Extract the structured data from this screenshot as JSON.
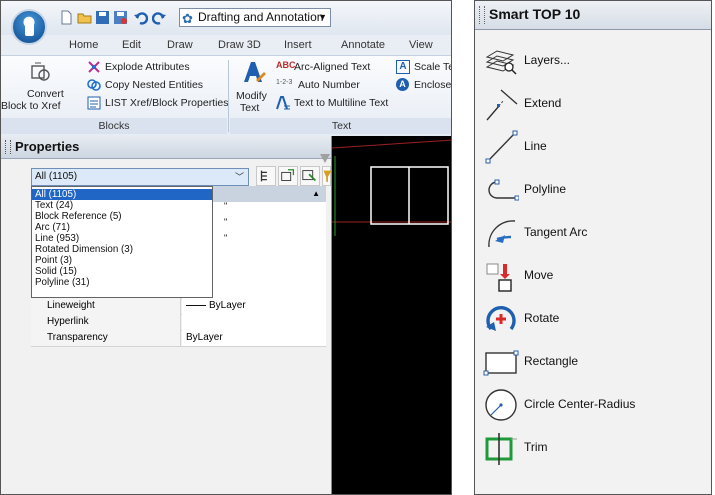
{
  "quick_access": {
    "workspace": "Drafting and Annotation"
  },
  "ribbon": {
    "tabs": [
      "Home",
      "Edit",
      "Draw",
      "Draw 3D",
      "Insert",
      "Annotate",
      "View"
    ],
    "blocks": {
      "convert_label_1": "Convert",
      "convert_label_2": "Block to Xref",
      "explode_attributes": "Explode Attributes",
      "copy_nested": "Copy Nested Entities",
      "list_xref": "LIST Xref/Block Properties",
      "group_label": "Blocks"
    },
    "text": {
      "modify_label_1": "Modify",
      "modify_label_2": "Text",
      "arc_aligned": "Arc-Aligned Text",
      "auto_number": "Auto Number",
      "text_to_multiline": "Text to Multiline Text",
      "scale_text": "Scale Tex",
      "enclose": "Enclose",
      "group_label": "Text"
    }
  },
  "properties": {
    "title": "Properties",
    "selection_value": "All (1105)",
    "dropdown_options": [
      "All (1105)",
      "Text (24)",
      "Block Reference (5)",
      "Arc (71)",
      "Line (953)",
      "Rotated Dimension (3)",
      "Point (3)",
      "Solid (15)",
      "Polyline (31)"
    ],
    "rows": [
      {
        "name": "Lineweight",
        "value": "ByLayer",
        "line": true
      },
      {
        "name": "Hyperlink",
        "value": ""
      },
      {
        "name": "Transparency",
        "value": "ByLayer"
      }
    ]
  },
  "smart_top": {
    "title": "Smart TOP 10",
    "items": [
      {
        "label": "Layers...",
        "icon": "layers-icon"
      },
      {
        "label": "Extend",
        "icon": "extend-icon"
      },
      {
        "label": "Line",
        "icon": "line-icon"
      },
      {
        "label": "Polyline",
        "icon": "polyline-icon"
      },
      {
        "label": "Tangent Arc",
        "icon": "tangent-arc-icon"
      },
      {
        "label": "Move",
        "icon": "move-icon"
      },
      {
        "label": "Rotate",
        "icon": "rotate-icon"
      },
      {
        "label": "Rectangle",
        "icon": "rectangle-icon"
      },
      {
        "label": "Circle Center-Radius",
        "icon": "circle-center-radius-icon"
      },
      {
        "label": "Trim",
        "icon": "trim-icon"
      }
    ]
  }
}
